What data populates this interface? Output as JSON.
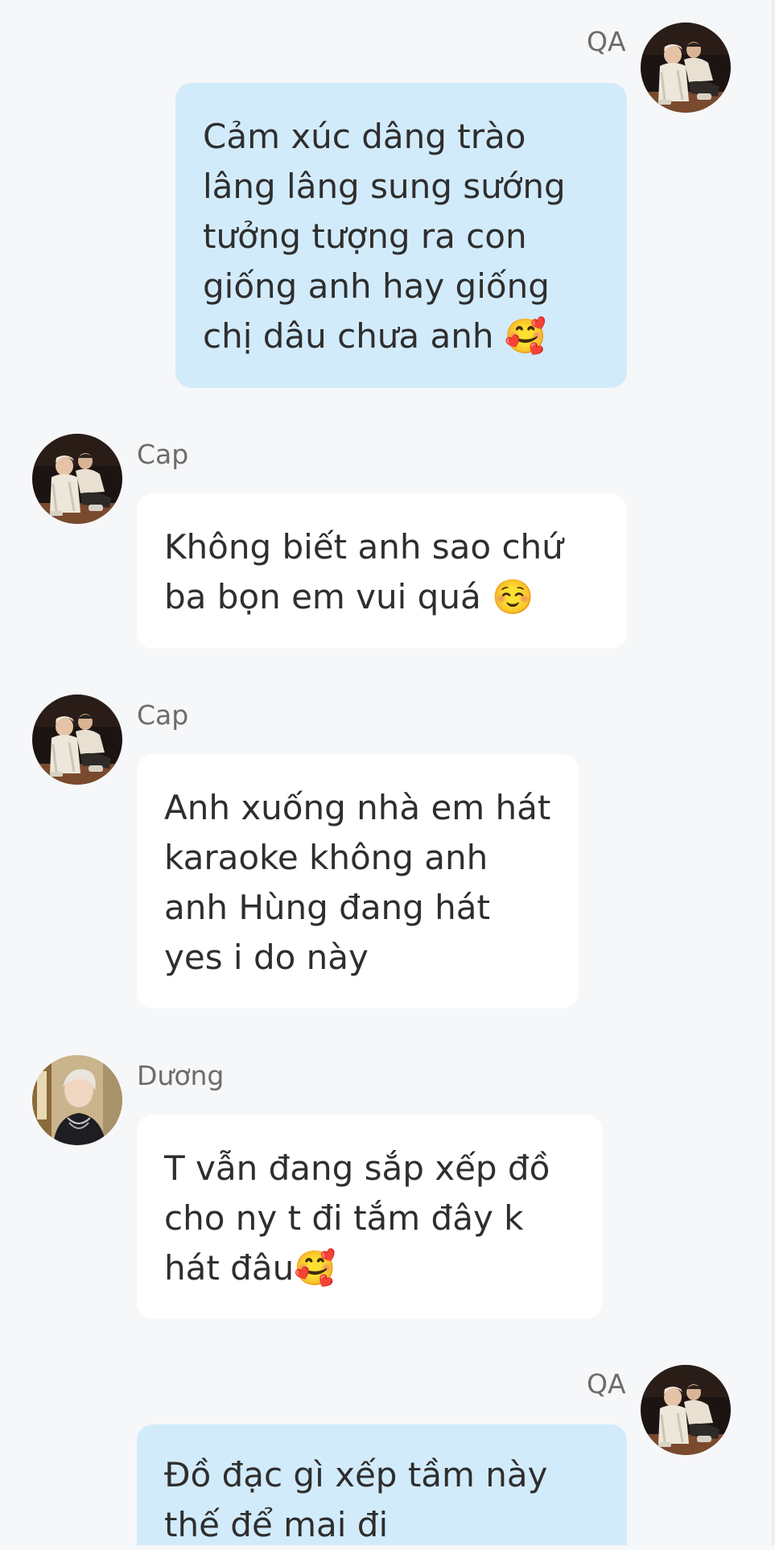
{
  "messages": [
    {
      "sender": "QA",
      "direction": "outgoing",
      "avatar_icon": "couple-photo-avatar",
      "text": "Cảm xúc dâng trào lâng lâng sung sướng tưởng tượng ra con giống anh hay giống chị dâu chưa anh 🥰"
    },
    {
      "sender": "Cap",
      "direction": "incoming",
      "avatar_icon": "couple-photo-avatar",
      "text": "Không biết anh sao chứ ba bọn em vui quá ☺️"
    },
    {
      "sender": "Cap",
      "direction": "incoming",
      "avatar_icon": "couple-photo-avatar",
      "text": "Anh xuống nhà em hát karaoke không anh anh Hùng đang hát yes i do này"
    },
    {
      "sender": "Dương",
      "direction": "incoming",
      "avatar_icon": "portrait-photo-avatar",
      "text": "T vẫn đang sắp xếp đồ cho ny t đi tắm đây k hát đâu🥰"
    },
    {
      "sender": "QA",
      "direction": "outgoing",
      "avatar_icon": "couple-photo-avatar",
      "text": "Đồ đạc gì xếp tầm này thế để mai đi"
    }
  ],
  "colors": {
    "background": "#f6f7f9",
    "incoming_bubble": "#ffffff",
    "outgoing_bubble": "#d2ebfb",
    "sender_name": "#6c6c6c"
  }
}
